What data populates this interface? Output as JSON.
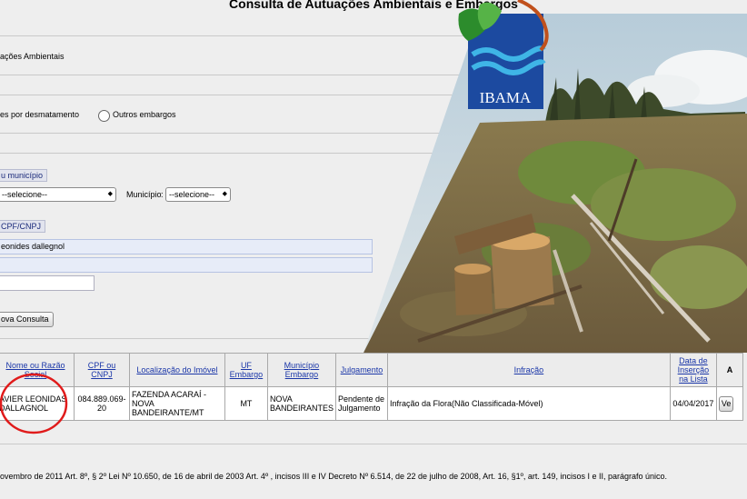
{
  "header": {
    "title": "Consulta de Autuações Ambientais e Embargos"
  },
  "brand": {
    "logo_text": "IBAMA",
    "color_green": "#2c8c2c",
    "color_blue": "#1c4aa0"
  },
  "form": {
    "type_label": "ações Ambientais",
    "radio_desmatamento": "es por desmatamento",
    "radio_outros": "Outros embargos",
    "uf_legend": "u município",
    "uf_select_value": "--selecione--",
    "municipio_label": "Município",
    "municipio_select_value": "--selecione--",
    "cpf_legend": "CPF/CNPJ",
    "name_value": "eonides dallegnol",
    "second_field_value": "",
    "third_field_value": "",
    "new_search_button": "ova Consulta"
  },
  "table": {
    "headers": [
      "Nome ou Razão Social",
      "CPF ou CNPJ",
      "Localização do Imóvel",
      "UF Embargo",
      "Município Embargo",
      "Julgamento",
      "Infração",
      "Data de Inserção na Lista",
      "A"
    ],
    "row": {
      "nome": "AVIER LEONIDAS DALLAGNOL",
      "cpf": "084.889.069-20",
      "localizacao": "FAZENDA ACARAÍ - NOVA BANDEIRANTE/MT",
      "uf": "MT",
      "municipio": "NOVA BANDEIRANTES",
      "julgamento": "Pendente de Julgamento",
      "infracao": "Infração da Flora(Não Classificada-Móvel)",
      "data": "04/04/2017",
      "action": "Ve"
    }
  },
  "footer": {
    "text": "ovembro de 2011 Art. 8º, § 2º Lei Nº 10.650, de 16 de abril de 2003 Art. 4º , incisos III e IV Decreto Nº 6.514, de 22 de julho de 2008, Art. 16, §1º, art. 149, incisos I e II, parágrafo único."
  }
}
